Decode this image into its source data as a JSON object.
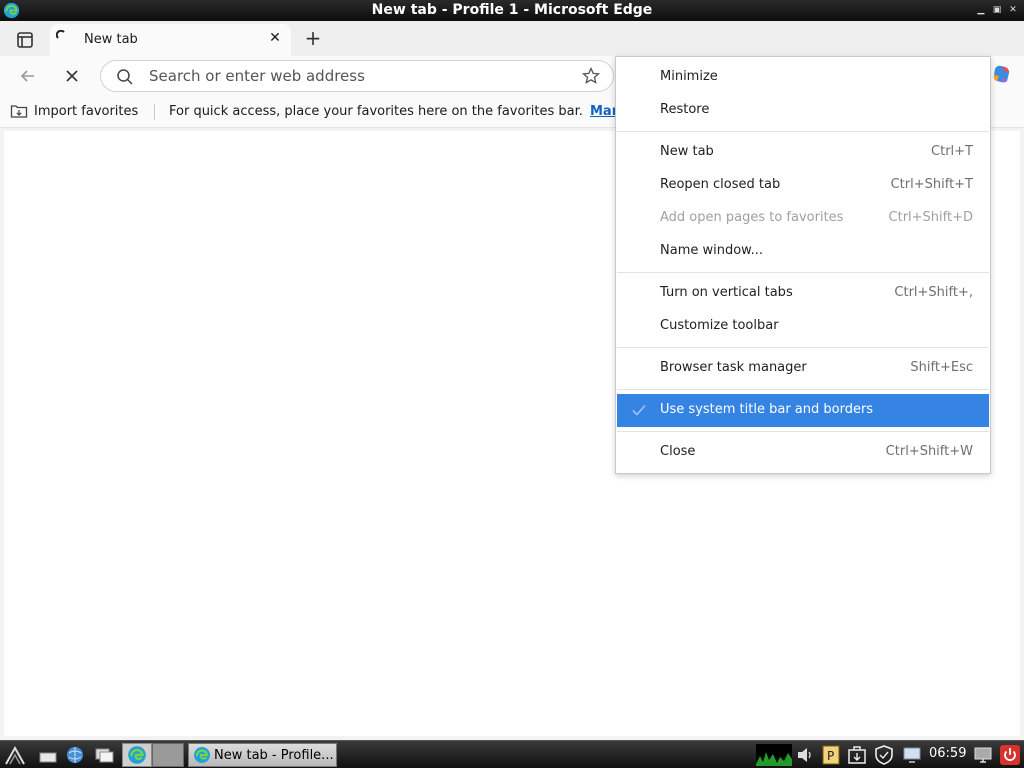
{
  "window": {
    "title": "New tab - Profile 1 - Microsoft Edge"
  },
  "tabs": [
    {
      "label": "New tab"
    }
  ],
  "omnibox": {
    "placeholder": "Search or enter web address"
  },
  "favorites_bar": {
    "import_label": "Import favorites",
    "hint": "For quick access, place your favorites here on the favorites bar.",
    "manage_link": "Manage favorites now"
  },
  "menu": {
    "items": [
      {
        "label": "Minimize",
        "shortcut": ""
      },
      {
        "label": "Restore",
        "shortcut": ""
      },
      {
        "label": "New tab",
        "shortcut": "Ctrl+T"
      },
      {
        "label": "Reopen closed tab",
        "shortcut": "Ctrl+Shift+T"
      },
      {
        "label": "Add open pages to favorites",
        "shortcut": "Ctrl+Shift+D",
        "disabled": true
      },
      {
        "label": "Name window...",
        "shortcut": ""
      },
      {
        "label": "Turn on vertical tabs",
        "shortcut": "Ctrl+Shift+,"
      },
      {
        "label": "Customize toolbar",
        "shortcut": ""
      },
      {
        "label": "Browser task manager",
        "shortcut": "Shift+Esc"
      },
      {
        "label": "Use system title bar and borders",
        "shortcut": "",
        "checked": true
      },
      {
        "label": "Close",
        "shortcut": "Ctrl+Shift+W"
      }
    ]
  },
  "taskbar": {
    "task_label": "New tab - Profile...",
    "clock": "06:59"
  },
  "colors": {
    "accent": "#3584e4",
    "link": "#0f62c0"
  }
}
